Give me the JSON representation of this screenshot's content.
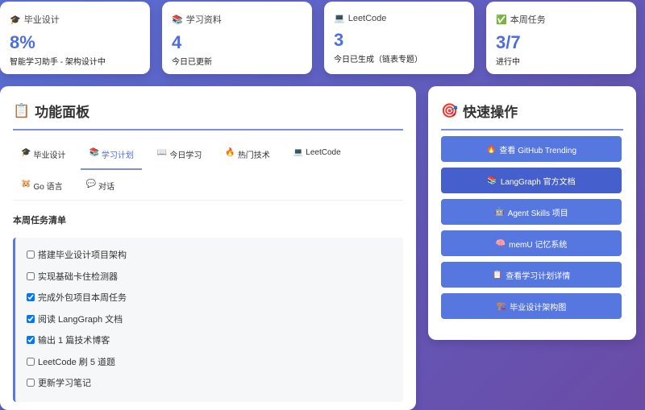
{
  "stats": [
    {
      "icon": "🎓",
      "label": "毕业设计",
      "value": "8%",
      "sub": "智能学习助手 - 架构设计中"
    },
    {
      "icon": "📚",
      "label": "学习资料",
      "value": "4",
      "sub": "今日已更新"
    },
    {
      "icon": "💻",
      "label": "LeetCode",
      "value": "3",
      "sub": "今日已生成（链表专题）"
    },
    {
      "icon": "✅",
      "label": "本周任务",
      "value": "3/7",
      "sub": "进行中"
    }
  ],
  "panel": {
    "icon": "📋",
    "title": "功能面板",
    "tabs": [
      {
        "icon": "🎓",
        "label": "毕业设计"
      },
      {
        "icon": "📚",
        "label": "学习计划"
      },
      {
        "icon": "📖",
        "label": "今日学习"
      },
      {
        "icon": "🔥",
        "label": "热门技术"
      },
      {
        "icon": "💻",
        "label": "LeetCode"
      },
      {
        "icon": "🐹",
        "label": "Go 语言"
      },
      {
        "icon": "💬",
        "label": "对话"
      }
    ],
    "section_title": "本周任务清单",
    "tasks": [
      {
        "label": "搭建毕业设计项目架构",
        "done": false
      },
      {
        "label": "实现基础卡住检测器",
        "done": false
      },
      {
        "label": "完成外包项目本周任务",
        "done": true
      },
      {
        "label": "阅读 LangGraph 文档",
        "done": true
      },
      {
        "label": "输出 1 篇技术博客",
        "done": true
      },
      {
        "label": "LeetCode 刷 5 道题",
        "done": false
      },
      {
        "label": "更新学习笔记",
        "done": false
      }
    ]
  },
  "quick": {
    "icon": "🎯",
    "title": "快速操作",
    "buttons": [
      {
        "icon": "🔥",
        "label": "查看 GitHub Trending"
      },
      {
        "icon": "📚",
        "label": "LangGraph 官方文档"
      },
      {
        "icon": "🤖",
        "label": "Agent Skills 项目"
      },
      {
        "icon": "🧠",
        "label": "memU 记忆系统"
      },
      {
        "icon": "📋",
        "label": "查看学习计划详情"
      },
      {
        "icon": "🏗️",
        "label": "毕业设计架构图"
      }
    ]
  }
}
